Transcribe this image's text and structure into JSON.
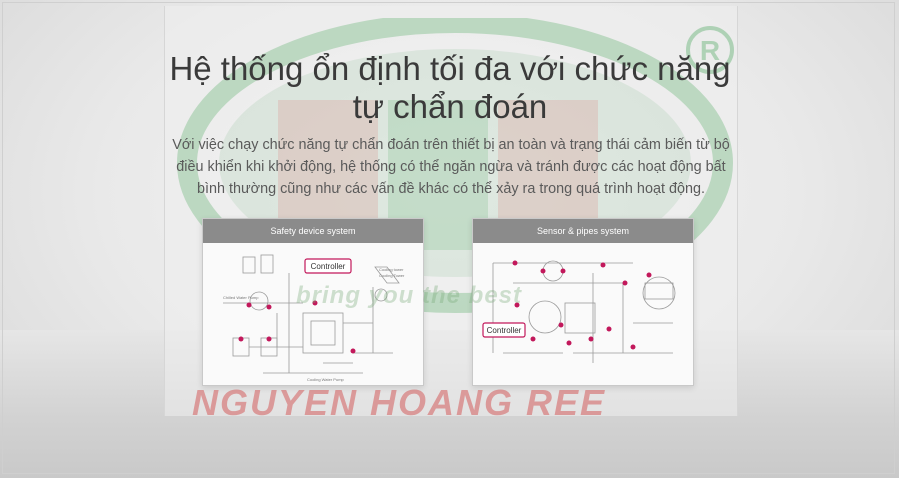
{
  "slide": {
    "title_line1": "Hệ thống ổn định tối đa với chức năng",
    "title_line2": "tự chẩn đoán",
    "description": "Với việc chạy chức năng tự chẩn đoán trên thiết bị an toàn và trạng thái cảm biến từ bộ điều khiển khi khởi động, hệ thống có thể ngăn ngừa và tránh được các hoạt động bất bình thường cũng như các vấn đề khác có thể xảy ra trong quá trình hoạt động."
  },
  "diagrams": [
    {
      "header": "Safety device system",
      "controller_label": "Controller",
      "labels": [
        "Cooling tower",
        "Chilled Water Pump",
        "Cooling Water Pump",
        "Cooling Tower"
      ]
    },
    {
      "header": "Sensor & pipes system",
      "controller_label": "Controller"
    }
  ],
  "watermark": {
    "brand": "NGUYEN HOANG REE",
    "tagline": "bring you the best"
  },
  "colors": {
    "highlight": "#c2185b",
    "watermark_green": "#2e9b4b",
    "watermark_red": "#d84343"
  }
}
